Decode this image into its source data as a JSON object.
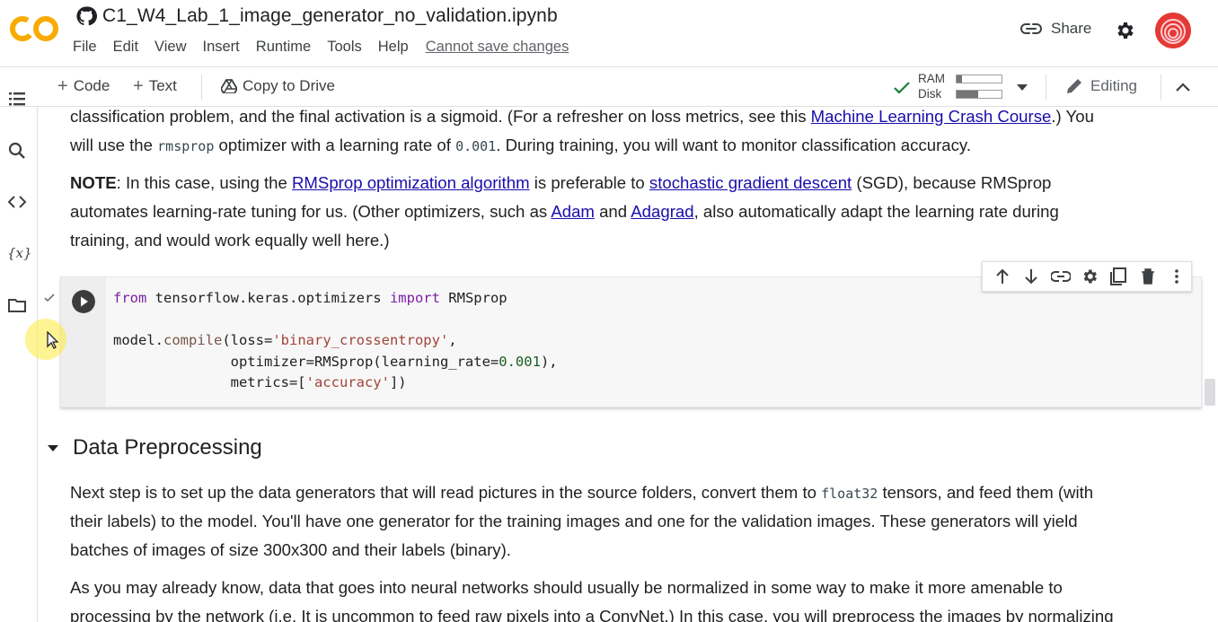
{
  "header": {
    "title": "C1_W4_Lab_1_image_generator_no_validation.ipynb",
    "logo_text": "CO",
    "menu": [
      "File",
      "Edit",
      "View",
      "Insert",
      "Runtime",
      "Tools",
      "Help"
    ],
    "cannot_save": "Cannot save changes",
    "share_label": "Share"
  },
  "toolbar": {
    "code_label": "Code",
    "text_label": "Text",
    "copy_label": "Copy to Drive",
    "ram_label": "RAM",
    "disk_label": "Disk",
    "ram_usage": 0.12,
    "disk_usage": 0.48,
    "editing_label": "Editing"
  },
  "sidebar": {
    "variables_label": "{x}"
  },
  "content": {
    "p1_line1_a": "classification problem, and the final activation is a sigmoid. (For a refresher on loss metrics, see this ",
    "p1_link": "Machine Learning Crash Course",
    "p1_line1_b": ".) You",
    "p1_line2_a": "will use the ",
    "p1_code1": "rmsprop",
    "p1_line2_b": " optimizer with a learning rate of ",
    "p1_code2": "0.001",
    "p1_line2_c": ". During training, you will want to monitor classification accuracy.",
    "note_bold": "NOTE",
    "note_a": ": In this case, using the ",
    "note_link1": "RMSprop optimization algorithm",
    "note_b": " is preferable to ",
    "note_link2": "stochastic gradient descent",
    "note_c": " (SGD), because RMSprop",
    "note_line2_a": "automates learning-rate tuning for us. (Other optimizers, such as ",
    "note_link3": "Adam",
    "note_line2_b": " and ",
    "note_link4": "Adagrad",
    "note_line2_c": ", also automatically adapt the learning rate during",
    "note_line3": "training, and would work equally well here.)",
    "code": {
      "l1_kw1": "from",
      "l1_mod": " tensorflow.keras.optimizers ",
      "l1_kw2": "import",
      "l1_name": " RMSprop",
      "l3_obj": "model.",
      "l3_fn": "compile",
      "l3_a": "(loss=",
      "l3_str": "'binary_crossentropy'",
      "l3_b": ",",
      "l4_a": "              optimizer=RMSprop(learning_rate=",
      "l4_num": "0.001",
      "l4_b": "),",
      "l5_a": "              metrics=[",
      "l5_str": "'accuracy'",
      "l5_b": "])"
    },
    "section_title": "Data Preprocessing",
    "dp1_a": "Next step is to set up the data generators that will read pictures in the source folders, convert them to ",
    "dp1_code": "float32",
    "dp1_b": " tensors, and feed them (with",
    "dp2": "their labels) to the model. You'll have one generator for the training images and one for the validation images. These generators will yield",
    "dp3": "batches of images of size 300x300 and their labels (binary).",
    "dp4": "As you may already know, data that goes into neural networks should usually be normalized in some way to make it more amenable to",
    "dp5": "processing by the network (i.e. It is uncommon to feed raw pixels into a ConvNet.) In this case, you will preprocess the images by normalizing"
  },
  "colors": {
    "link": "#1a0dab",
    "accent_orange": "#f9ab00",
    "keyword": "#7b1fa2"
  }
}
